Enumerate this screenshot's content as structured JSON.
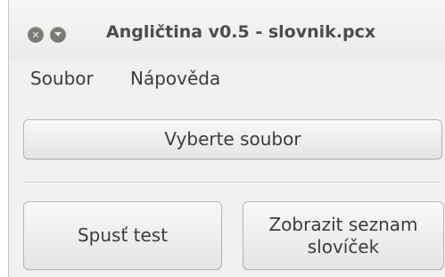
{
  "window": {
    "title": "Angličtina v0.5 - slovnik.pcx",
    "controls": {
      "close_icon": "close-icon",
      "minimize_icon": "minimize-icon"
    }
  },
  "menu": {
    "items": [
      {
        "label": "Soubor"
      },
      {
        "label": "Nápověda"
      }
    ]
  },
  "buttons": {
    "select_file": "Vyberte soubor",
    "start_test": "Spusť test",
    "show_list": "Zobrazit seznam slovíček"
  },
  "colors": {
    "window_bg": "#f2f1f0",
    "button_text": "#3c3c3c",
    "title_text": "#4c4c4c",
    "control_buttons": "#7b7a76"
  }
}
